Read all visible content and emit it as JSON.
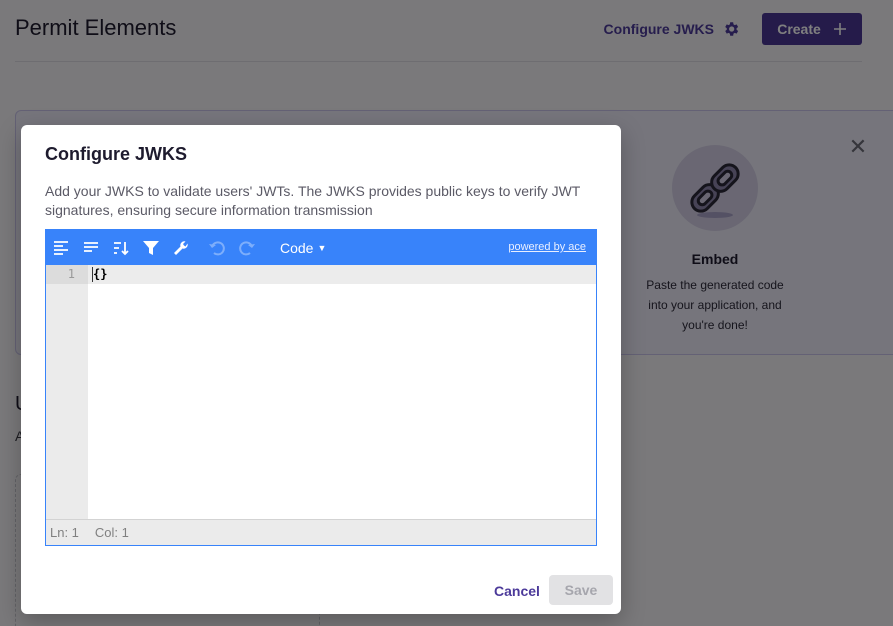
{
  "page": {
    "title": "Permit Elements",
    "configure_jwks_label": "Configure JWKS",
    "create_label": "Create",
    "create_icon": "plus-icon",
    "configure_icon": "gear-icon",
    "close_icon": "close-icon"
  },
  "embed_card": {
    "icon": "link-chain-icon",
    "title": "Embed",
    "description": "Paste the generated code into your application, and you're done!"
  },
  "background": {
    "partial_heading": "U",
    "partial_text": "A"
  },
  "modal": {
    "title": "Configure JWKS",
    "description": "Add your JWKS to validate users' JWTs. The JWKS provides public keys to verify JWT signatures, ensuring secure information transmission",
    "editor": {
      "toolbar": [
        "format-icon",
        "compact-icon",
        "sort-icon",
        "filter-icon",
        "repair-icon",
        "undo-icon",
        "redo-icon"
      ],
      "mode_label": "Code",
      "powered_by": "powered by ace",
      "line_number": "1",
      "content": "{}",
      "status_ln": "Ln: 1",
      "status_col": "Col: 1"
    },
    "cancel_label": "Cancel",
    "save_label": "Save"
  },
  "colors": {
    "accent": "#4a3795",
    "editor_blue": "#3883fa"
  }
}
